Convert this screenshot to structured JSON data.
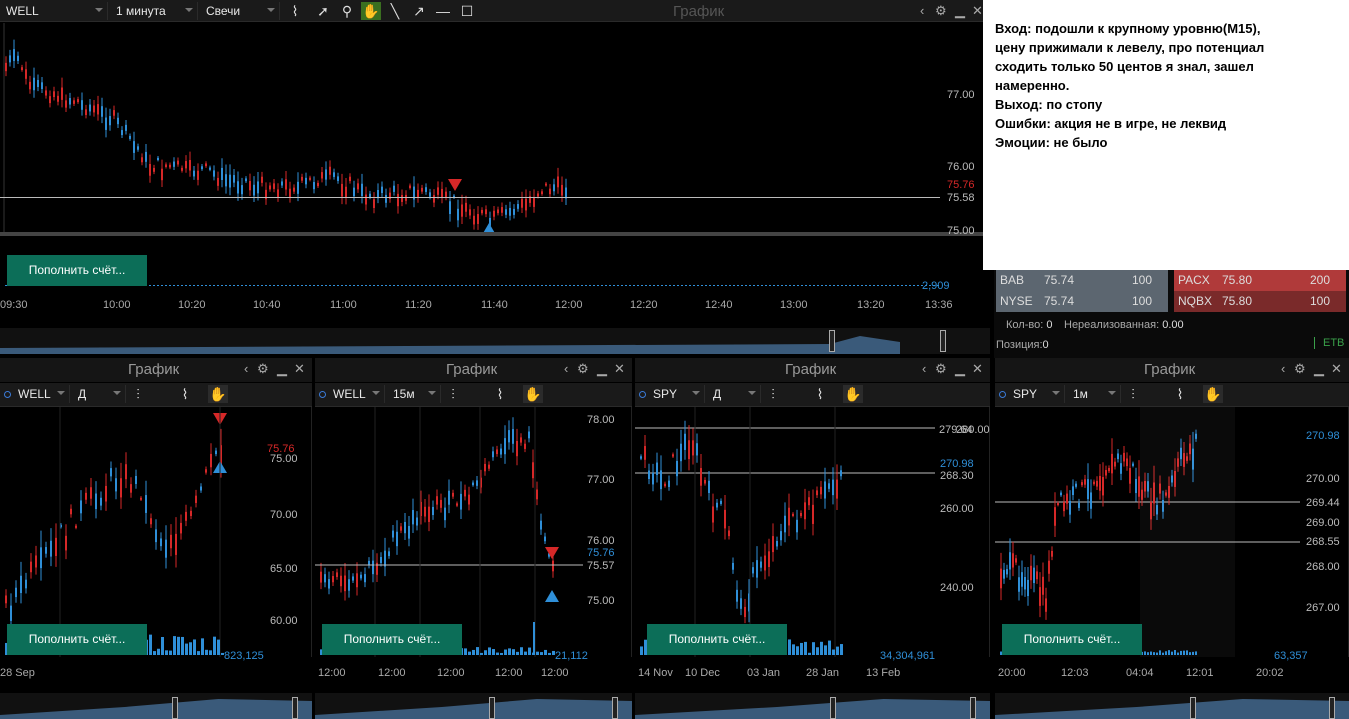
{
  "main": {
    "toolbar": {
      "symbol": "WELL",
      "timeframe": "1 минута",
      "chart_type": "Свечи",
      "title": "График"
    },
    "prices": [
      "77.00",
      "76.00",
      "75.76",
      "75.58",
      "75.00"
    ],
    "volume_label": "2,909",
    "times": [
      "09:30",
      "10:00",
      "10:20",
      "10:40",
      "11:00",
      "11:20",
      "11:40",
      "12:00",
      "12:20",
      "12:40",
      "13:00",
      "13:20",
      "13:36"
    ],
    "deposit_label": "Пополнить счёт..."
  },
  "note": {
    "lines": [
      "Вход: подошли к крупному уровню(M15),",
      "цену прижимали к левелу, про потенциал",
      "сходить только 50 центов я знал, зашел",
      "намеренно.",
      "Выход: по стопу",
      "Ошибки: акция не в игре, не леквид",
      "Эмоции: не было"
    ]
  },
  "book": {
    "bids": [
      {
        "exch": "BAB",
        "price": "75.74",
        "size": "100"
      },
      {
        "exch": "NYSE",
        "price": "75.74",
        "size": "100"
      }
    ],
    "asks": [
      {
        "exch": "PACX",
        "price": "75.80",
        "size": "200"
      },
      {
        "exch": "NQBX",
        "price": "75.80",
        "size": "100"
      }
    ],
    "qty_label": "Кол-во:",
    "qty": "0",
    "unreal_label": "Нереализованная:",
    "unreal": "0.00",
    "pos_label": "Позиция:",
    "pos": "0",
    "route": "ETB"
  },
  "panels": [
    {
      "title": "График",
      "symbol": "WELL",
      "tf": "Д",
      "prices": [
        "75.76",
        "75.00",
        "70.00",
        "65.00",
        "60.00"
      ],
      "volume": "823,125",
      "times": [
        "28 Sep"
      ],
      "deposit": "Пополнить счёт..."
    },
    {
      "title": "График",
      "symbol": "WELL",
      "tf": "15м",
      "prices": [
        "78.00",
        "77.00",
        "76.00",
        "75.76",
        "75.57",
        "75.00"
      ],
      "volume": "21,112",
      "times": [
        "12:00",
        "12:00",
        "12:00",
        "12:00",
        "12:00"
      ],
      "deposit": "Пополнить счёт..."
    },
    {
      "title": "График",
      "symbol": "SPY",
      "tf": "Д",
      "prices": [
        "279.64",
        "280.00",
        "270.98",
        "268.30",
        "260.00",
        "240.00"
      ],
      "volume": "34,304,961",
      "times": [
        "14 Nov",
        "10 Dec",
        "03 Jan",
        "28 Jan",
        "13 Feb"
      ],
      "deposit": "Пополнить счёт..."
    },
    {
      "title": "График",
      "symbol": "SPY",
      "tf": "1м",
      "prices": [
        "270.98",
        "270.00",
        "269.44",
        "269.00",
        "268.55",
        "268.00",
        "267.00"
      ],
      "volume": "63,357",
      "times": [
        "20:00",
        "12:03",
        "04:04",
        "12:01",
        "20:02"
      ],
      "deposit": "Пополнить счёт..."
    }
  ],
  "colors": {
    "up": "#2f8fd8",
    "down": "#d62828",
    "deposit": "#0c6e58",
    "bid": "#5c6670",
    "ask": "#b03a3a"
  }
}
